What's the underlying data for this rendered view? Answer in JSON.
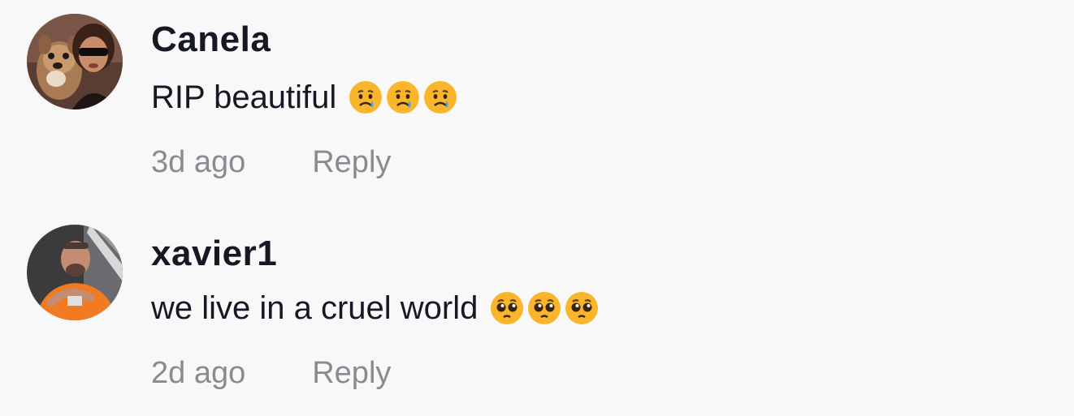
{
  "comments": [
    {
      "username": "Canela",
      "text": "RIP beautiful",
      "emoji": [
        "crying-face-emoji",
        "crying-face-emoji",
        "crying-face-emoji"
      ],
      "time": "3d ago",
      "reply_label": "Reply"
    },
    {
      "username": "xavier1",
      "text": "we live in a cruel world",
      "emoji": [
        "pleading-face-emoji",
        "pleading-face-emoji",
        "pleading-face-emoji"
      ],
      "time": "2d ago",
      "reply_label": "Reply"
    }
  ],
  "colors": {
    "background": "#f8f8f8",
    "username": "#161823",
    "text": "#161823",
    "meta": "#8a8b91",
    "emoji_face": "#f9b62c"
  }
}
